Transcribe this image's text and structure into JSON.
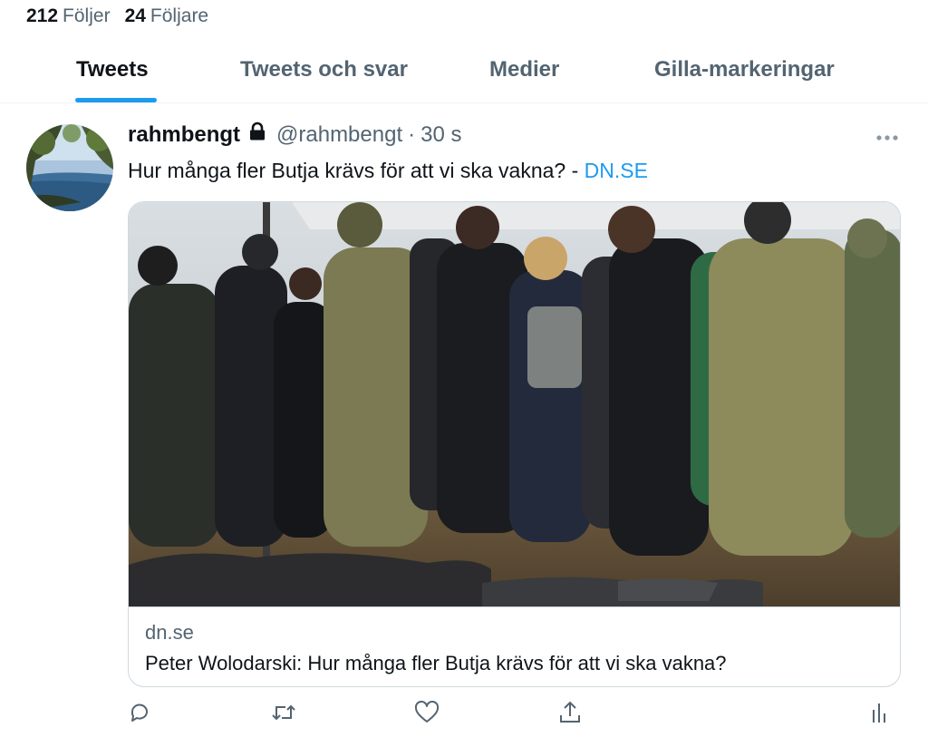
{
  "profile_stats": {
    "following_count": "212",
    "following_label": "Följer",
    "followers_count": "24",
    "followers_label": "Följare"
  },
  "tabs": [
    {
      "label": "Tweets",
      "active": true
    },
    {
      "label": "Tweets och svar",
      "active": false
    },
    {
      "label": "Medier",
      "active": false
    },
    {
      "label": "Gilla-markeringar",
      "active": false
    }
  ],
  "tweet": {
    "author_name": "rahmbengt",
    "handle": "@rahmbengt",
    "separator": "·",
    "time": "30 s",
    "text": "Hur många fler Butja krävs för att vi ska vakna? - ",
    "link_text": "DN.SE",
    "icons": {
      "lock": "lock-icon",
      "more": "more-horizontal-icon",
      "reply": "reply-icon",
      "retweet": "retweet-icon",
      "like": "like-icon",
      "share": "share-icon",
      "analytics": "analytics-icon"
    }
  },
  "link_card": {
    "domain": "dn.se",
    "title": "Peter Wolodarski: Hur många fler Butja krävs för att vi ska vakna?"
  },
  "colors": {
    "accent": "#1d9bf0",
    "text_primary": "#0f1419",
    "text_secondary": "#536471",
    "border": "#cfd9de"
  }
}
